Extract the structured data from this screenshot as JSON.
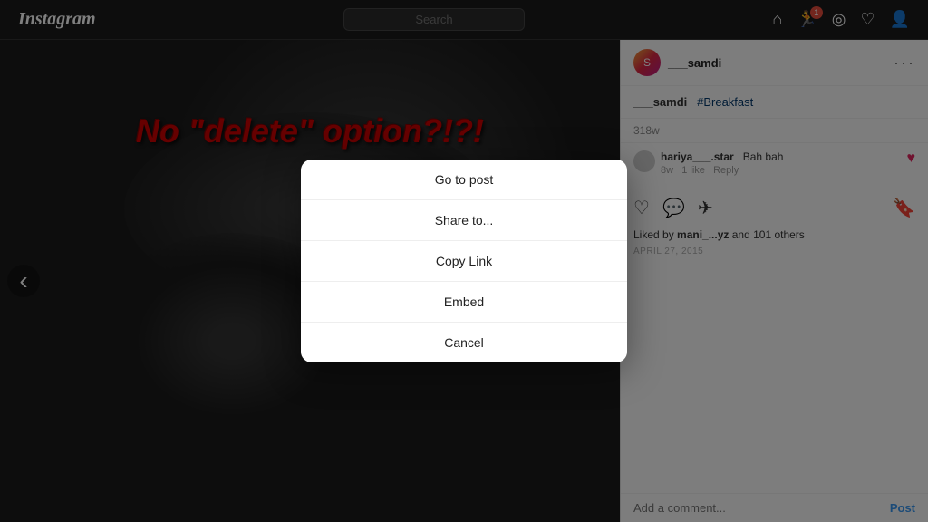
{
  "app": {
    "name": "Instagram",
    "logo": "Instagram"
  },
  "navbar": {
    "search_placeholder": "Search",
    "icons": [
      "home",
      "activity",
      "explore",
      "heart",
      "profile"
    ],
    "activity_badge": "1"
  },
  "overlay_text": "No \"delete\" option?!?!",
  "post": {
    "username": "___samdi",
    "caption_user": "___samdi",
    "hashtags": "#Breakfast",
    "likes_count": "318w",
    "comment": {
      "user": "hariya___.star",
      "text": "Bah bah",
      "time": "8w",
      "likes": "1 like",
      "reply": "Reply"
    },
    "liked_by_user": "mani_...yz",
    "liked_by_others": "101 others",
    "date": "APRIL 27, 2015",
    "comment_placeholder": "Add a comment...",
    "post_button": "Post"
  },
  "modal": {
    "items": [
      {
        "label": "Go to post",
        "id": "go-to-post"
      },
      {
        "label": "Share to...",
        "id": "share-to"
      },
      {
        "label": "Copy Link",
        "id": "copy-link"
      },
      {
        "label": "Embed",
        "id": "embed"
      },
      {
        "label": "Cancel",
        "id": "cancel"
      }
    ]
  }
}
